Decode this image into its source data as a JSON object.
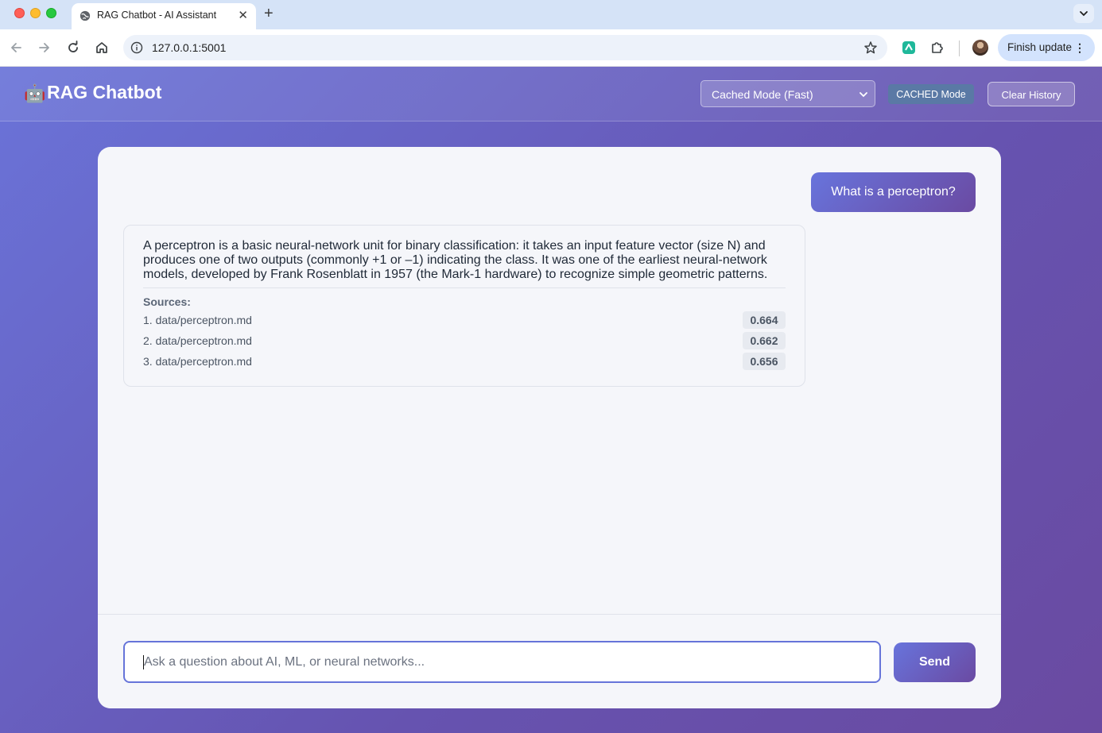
{
  "browser": {
    "tab_title": "RAG Chatbot - AI Assistant",
    "url": "127.0.0.1:5001",
    "finish_update_label": "Finish update"
  },
  "header": {
    "logo_emoji": "🤖",
    "title": "RAG Chatbot",
    "mode_select_value": "Cached Mode (Fast)",
    "mode_badge": "CACHED Mode",
    "clear_history_label": "Clear History"
  },
  "messages": [
    {
      "role": "user",
      "text": "What is a perceptron?"
    },
    {
      "role": "assistant",
      "text": "A perceptron is a basic neural-network unit for binary classification: it takes an input feature vector (size N) and produces one of two outputs (commonly +1 or –1) indicating the class. It was one of the earliest neural-network models, developed by Frank Rosenblatt in 1957 (the Mark-1 hardware) to recognize simple geometric patterns.",
      "sources_label": "Sources:",
      "sources": [
        {
          "name": "1. data/perceptron.md",
          "score": "0.664"
        },
        {
          "name": "2. data/perceptron.md",
          "score": "0.662"
        },
        {
          "name": "3. data/perceptron.md",
          "score": "0.656"
        }
      ]
    }
  ],
  "input": {
    "placeholder": "Ask a question about AI, ML, or neural networks...",
    "value": "",
    "send_label": "Send"
  },
  "colors": {
    "accent_start": "#6874dc",
    "accent_end": "#6a4aa2",
    "mode_badge": "#5a79a5"
  }
}
